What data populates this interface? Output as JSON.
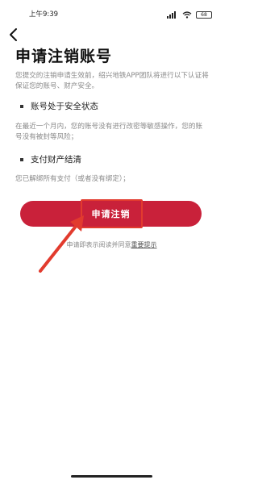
{
  "status_bar": {
    "time": "上午9:39",
    "battery": "68",
    "icons": [
      "signal-icon",
      "wifi-icon",
      "battery-icon"
    ]
  },
  "page": {
    "title": "申请注销账号",
    "intro": "您提交的注销申请生效前，绍兴地铁APP团队将进行以下认证将保证您的账号、财产安全。"
  },
  "conditions": [
    {
      "title": "账号处于安全状态",
      "description": "在最近一个月内，您的账号没有进行改密等敏感操作，您的账号没有被封等风险；"
    },
    {
      "title": "支付财产结清",
      "description": "您已解绑所有支付（或者没有绑定）；"
    }
  ],
  "apply_button": {
    "label": "申请注销",
    "color": "#c9213a"
  },
  "agreement": {
    "text": "申请即表示阅读并同意",
    "link": "重要提示"
  },
  "colors": {
    "annotation_red": "#e23b2e"
  }
}
